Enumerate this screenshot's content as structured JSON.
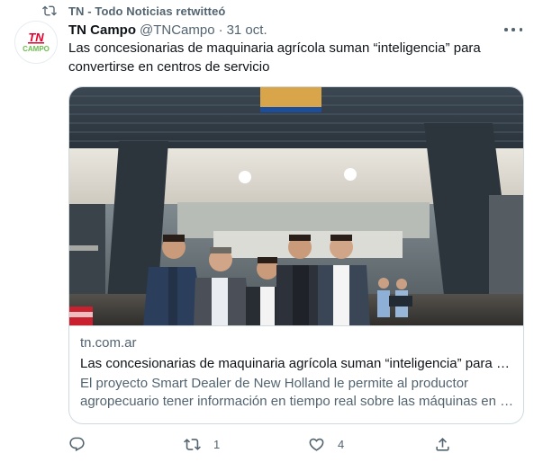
{
  "retweet_header": {
    "text": "TN - Todo Noticias retwitteó",
    "icon": "retweet-icon"
  },
  "author": {
    "avatar_text_top": "TN",
    "avatar_text_bottom": "CAMPO",
    "name": "TN Campo",
    "handle": "@TNCampo",
    "separator": "·",
    "date": "31 oct."
  },
  "tweet": {
    "text": "Las concesionarias de maquinaria agrícola suman “inteligencia” para convertirse en centros de servicio"
  },
  "card": {
    "domain": "tn.com.ar",
    "title": "Las concesionarias de maquinaria agrícola suman “inteligencia” para convertirse en centros de servicio",
    "description_line1": "El proyecto Smart Dealer de New Holland le permite al productor",
    "description_line2": "agropecuario tener información en tiempo real sobre las máquinas en sus campos"
  },
  "actions": {
    "reply": {
      "icon": "reply-icon",
      "count": ""
    },
    "retweet": {
      "icon": "retweet-icon",
      "count": "1"
    },
    "like": {
      "icon": "heart-icon",
      "count": "4"
    },
    "share": {
      "icon": "share-icon",
      "count": ""
    }
  },
  "colors": {
    "text_primary": "#0f1419",
    "text_secondary": "#536471",
    "border": "#cfd9de",
    "brand_red": "#e4002b",
    "brand_green": "#6abf4b"
  }
}
